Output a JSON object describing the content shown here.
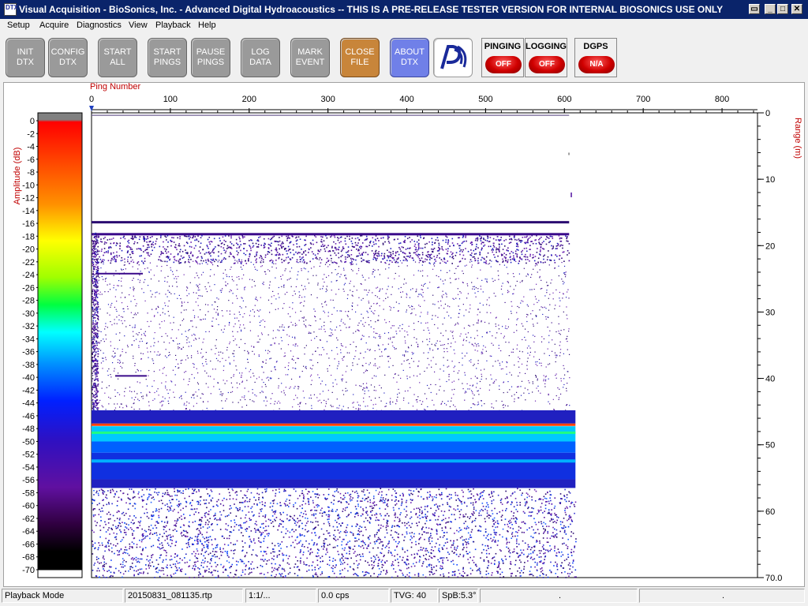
{
  "window": {
    "title": "Visual Acquisition  -  BioSonics, Inc.  -  Advanced Digital Hydroacoustics  -- THIS IS A PRE-RELEASE TESTER VERSION FOR INTERNAL BIOSONICS USE ONLY",
    "app_icon_text": "DTX",
    "controls": [
      "restore-down",
      "minimize",
      "maximize",
      "close"
    ]
  },
  "menu": [
    "Setup",
    "Acquire",
    "Diagnostics",
    "View",
    "Playback",
    "Help"
  ],
  "toolbar": {
    "buttons": [
      {
        "l1": "INIT",
        "l2": "DTX",
        "style": "gray"
      },
      {
        "l1": "CONFIG",
        "l2": "DTX",
        "style": "gray"
      },
      {
        "l1": "START",
        "l2": "ALL",
        "style": "gray"
      },
      {
        "l1": "START",
        "l2": "PINGS",
        "style": "gray"
      },
      {
        "l1": "PAUSE",
        "l2": "PINGS",
        "style": "gray"
      },
      {
        "l1": "LOG",
        "l2": "DATA",
        "style": "gray"
      },
      {
        "l1": "MARK",
        "l2": "EVENT",
        "style": "gray"
      },
      {
        "l1": "CLOSE",
        "l2": "FILE",
        "style": "orange"
      },
      {
        "l1": "ABOUT",
        "l2": "DTX",
        "style": "blue"
      }
    ],
    "logo_icon": "biosonics-logo-icon",
    "indicators": [
      {
        "label": "PINGING",
        "state": "OFF",
        "color": "#d00000"
      },
      {
        "label": "LOGGING",
        "state": "OFF",
        "color": "#d00000"
      },
      {
        "label": "DGPS",
        "state": "N/A",
        "color": "#d00000"
      }
    ]
  },
  "echogram": {
    "x_label": "Ping Number",
    "x_ticks": [
      0,
      100,
      200,
      300,
      400,
      500,
      600,
      700,
      800
    ],
    "y_label": "Range (m)",
    "y_ticks": [
      0,
      10,
      20,
      30,
      40,
      50,
      60,
      "70.0"
    ],
    "color_label": "Amplitude (dB)",
    "color_ticks": [
      0,
      -2,
      -4,
      -6,
      -8,
      -10,
      -12,
      -14,
      -16,
      -18,
      -20,
      -22,
      -24,
      -26,
      -28,
      -30,
      -32,
      -34,
      -36,
      -38,
      -40,
      -42,
      -44,
      -46,
      -48,
      -50,
      -52,
      -54,
      -56,
      -58,
      -60,
      -62,
      -64,
      -66,
      -68,
      -70
    ],
    "data_end_ping": 606,
    "max_range_m": 70,
    "ping_axis_max": 845
  },
  "status": {
    "mode": "Playback Mode",
    "file": "20150831_081135.rtp",
    "ratio": "1:1/...",
    "cps": "0.0 cps",
    "tvg": "TVG: 40",
    "spb": "SpB:5.3°",
    "extra1": ".",
    "extra2": "."
  },
  "colors": {
    "titlebar": "#0a246a",
    "axis_label": "#c00000",
    "bottom_band": "#00c8ff",
    "school_layer": "#2020c0"
  }
}
